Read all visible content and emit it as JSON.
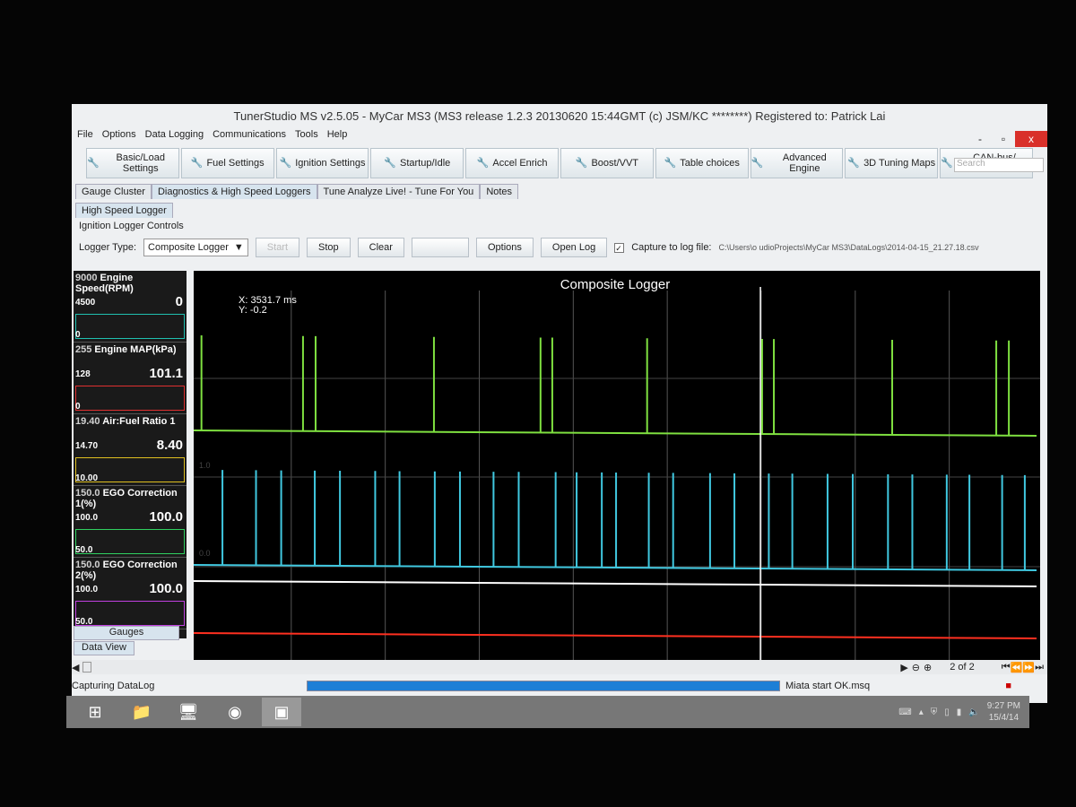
{
  "window": {
    "title": "TunerStudio MS v2.5.05 - MyCar MS3 (MS3 release 1.2.3   20130620 15:44GMT (c) JSM/KC ********) Registered to: Patrick Lai",
    "minimize": "-",
    "restore": "▫",
    "close": "x"
  },
  "menu": [
    "File",
    "Options",
    "Data Logging",
    "Communications",
    "Tools",
    "Help"
  ],
  "toolbar": [
    {
      "label": "Basic/Load Settings",
      "icon": "engine-icon"
    },
    {
      "label": "Fuel Settings",
      "icon": "engine-icon"
    },
    {
      "label": "Ignition Settings",
      "icon": "spark-icon"
    },
    {
      "label": "Startup/Idle",
      "icon": "wrench-icon"
    },
    {
      "label": "Accel Enrich",
      "icon": "tools-icon"
    },
    {
      "label": "Boost/VVT",
      "icon": "wrench-icon"
    },
    {
      "label": "Table choices",
      "icon": "wrench-icon"
    },
    {
      "label": "Advanced Engine",
      "icon": "tools-icon"
    },
    {
      "label": "3D Tuning Maps",
      "icon": "wrench-icon"
    },
    {
      "label": "CAN-bus/ Testmodes",
      "icon": "wrench-icon"
    }
  ],
  "search_placeholder": "Search",
  "tabs": [
    "Gauge Cluster",
    "Diagnostics & High Speed Loggers",
    "Tune Analyze Live! - Tune For You",
    "Notes"
  ],
  "subtab": "High Speed Logger",
  "controls": {
    "section": "Ignition Logger Controls",
    "logger_type_label": "Logger Type:",
    "logger_type": "Composite Logger",
    "start": "Start",
    "stop": "Stop",
    "clear": "Clear",
    "options": "Options",
    "open_log": "Open Log",
    "capture_label": "Capture to log file:",
    "capture_checked": true,
    "log_path": "C:\\Users\\o     udioProjects\\MyCar MS3\\DataLogs\\2014-04-15_21.27.18.csv"
  },
  "gauges": [
    {
      "max": "9000",
      "title": "Engine Speed(RPM)",
      "mid": "4500",
      "min": "0",
      "value": "0",
      "color": "#20c0b0"
    },
    {
      "max": "255",
      "title": "Engine MAP(kPa)",
      "mid": "128",
      "min": "0",
      "value": "101.1",
      "color": "#e03030"
    },
    {
      "max": "19.40",
      "title": "Air:Fuel Ratio 1",
      "mid": "14.70",
      "min": "10.00",
      "value": "8.40",
      "color": "#e0c020"
    },
    {
      "max": "150.0",
      "title": "EGO Correction 1(%)",
      "mid": "100.0",
      "min": "50.0",
      "value": "100.0",
      "color": "#30d060"
    },
    {
      "max": "150.0",
      "title": "EGO Correction 2(%)",
      "mid": "100.0",
      "min": "50.0",
      "value": "100.0",
      "color": "#c040e0"
    }
  ],
  "gauge_tabs": [
    "Gauges",
    "Data View"
  ],
  "chart_data": {
    "type": "line",
    "title": "Composite Logger",
    "cursor": {
      "x": "X: 3531.7 ms",
      "y": "Y: -0.2"
    },
    "ytick_labels": [
      "1.0",
      "0.0"
    ],
    "grid": true,
    "xrange": [
      0,
      100
    ],
    "series": [
      {
        "color": "#7fe040",
        "kind": "pulses",
        "x": [
          0.5,
          12.6,
          14.1,
          28.2,
          40.9,
          42.3,
          53.6,
          67.3,
          68.7,
          82.8,
          95.2,
          96.7
        ]
      },
      {
        "color": "#40c8e0",
        "kind": "pulses",
        "x": [
          3.0,
          7.0,
          10.0,
          14.0,
          17.0,
          21.2,
          24.1,
          28.3,
          31.3,
          35.3,
          38.3,
          42.7,
          45.2,
          48.2,
          49.9,
          53.8,
          56.7,
          61.1,
          64.0,
          68.1,
          70.9,
          75.1,
          78.1,
          82.3,
          85.2,
          89.3,
          92.0,
          95.9,
          98.6
        ]
      },
      {
        "color": "#ffffff",
        "kind": "flat",
        "x": []
      },
      {
        "color": "#ff3020",
        "kind": "flat",
        "x": []
      }
    ],
    "cursor_x": 67.1
  },
  "pager": {
    "page": "2",
    "of": "of",
    "total": "2"
  },
  "status": {
    "left": "Capturing DataLog",
    "progress": 1.0,
    "right": "Miata start OK.msq"
  },
  "tray": {
    "time": "9:27 PM",
    "date": "15/4/14"
  }
}
